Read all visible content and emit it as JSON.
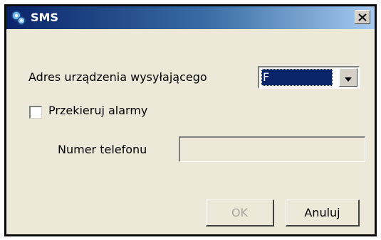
{
  "window": {
    "title": "SMS",
    "icon": "sms-gear-icon",
    "close_glyph": "✕",
    "titlebar_colors": [
      "#0a246a",
      "#a6caf0"
    ]
  },
  "form": {
    "sender_address_label": "Adres urządzenia wysyłającego",
    "sender_address_value": "F",
    "redirect_alarms_label": "Przekieruj alarmy",
    "redirect_alarms_checked": false,
    "phone_number_label": "Numer telefonu",
    "phone_number_value": ""
  },
  "buttons": {
    "ok_label": "OK",
    "ok_enabled": false,
    "cancel_label": "Anuluj"
  }
}
